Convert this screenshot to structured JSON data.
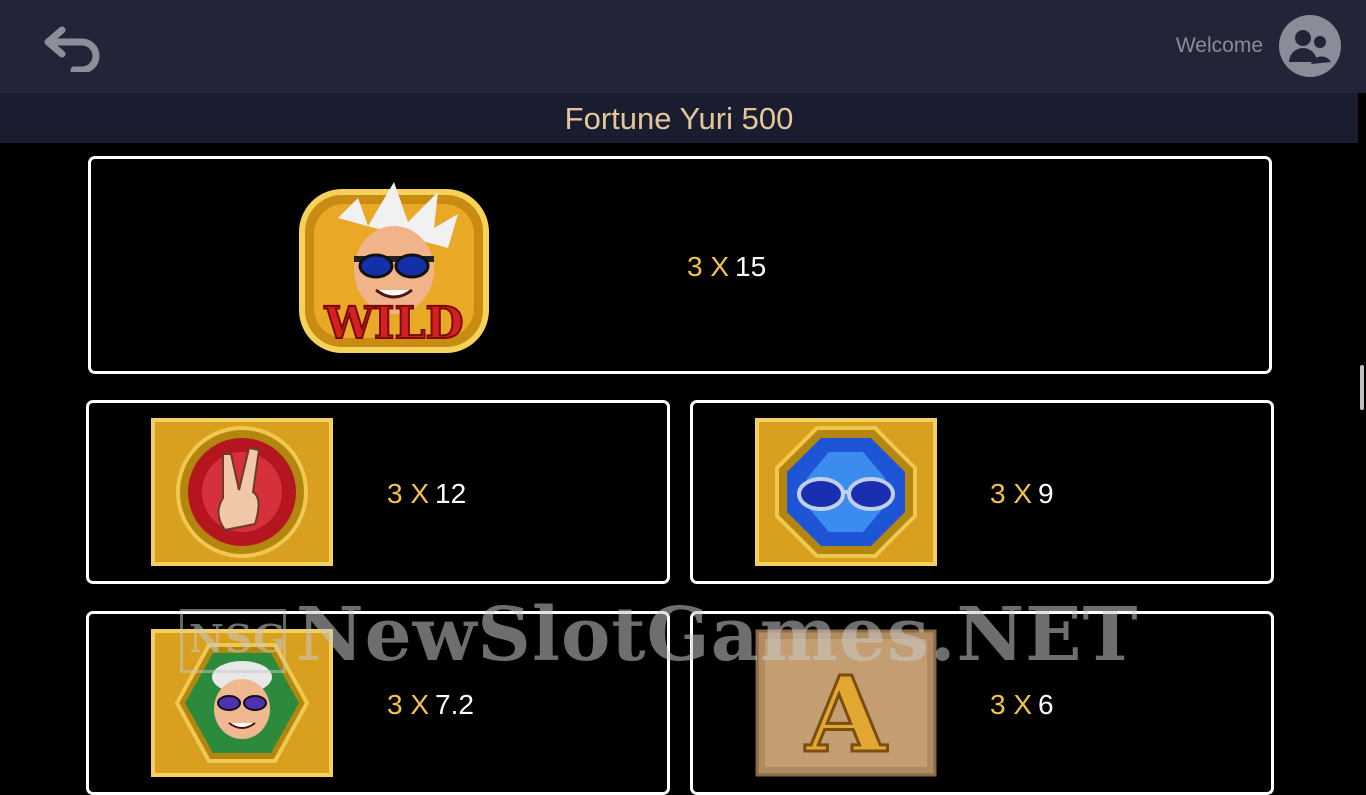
{
  "header": {
    "welcome_label": "Welcome",
    "title": "Fortune Yuri 500"
  },
  "watermark": {
    "text": "NewSlotGames.NET",
    "logo_text": "NSG"
  },
  "paytable": [
    {
      "symbol": "wild-symbol",
      "symbol_text": "WILD",
      "combo": "3 X",
      "payout": "15"
    },
    {
      "symbol": "peace-hand-symbol",
      "combo": "3 X",
      "payout": "12"
    },
    {
      "symbol": "sunglasses-gem-symbol",
      "combo": "3 X",
      "payout": "9"
    },
    {
      "symbol": "yuri-face-symbol",
      "combo": "3 X",
      "payout": "7.2"
    },
    {
      "symbol": "letter-a-symbol",
      "symbol_text": "A",
      "combo": "3 X",
      "payout": "6"
    }
  ],
  "colors": {
    "topbar": "#222538",
    "titlebar": "#1a1c30",
    "title_text": "#e3c79a",
    "multiplier": "#f3c24a",
    "card_border": "#ffffff",
    "background": "#000000"
  }
}
